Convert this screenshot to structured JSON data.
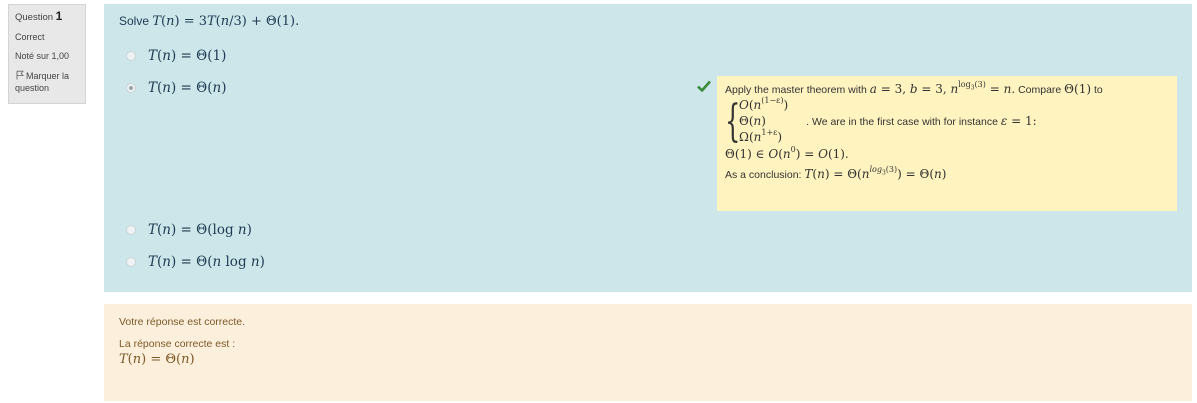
{
  "info": {
    "question_label": "Question",
    "question_number": "1",
    "state": "Correct",
    "grade": "Noté sur 1,00",
    "flag_label": "Marquer la question"
  },
  "question": {
    "prompt_word": "Solve",
    "options": [
      {
        "label": "T(n) = Θ(1)",
        "checked": false
      },
      {
        "label": "T(n) = Θ(n)",
        "checked": true
      },
      {
        "label": "T(n) = Θ(log n)",
        "checked": false
      },
      {
        "label": "T(n) = Θ(n log n)",
        "checked": false
      }
    ]
  },
  "feedback": {
    "intro": "Apply the master theorem with",
    "compare": "Compare",
    "to": "to",
    "first_case_text": "We are in the first case with for instance",
    "conclusion_label": "As a conclusion:"
  },
  "outcome": {
    "correct_text": "Votre réponse est correcte.",
    "right_answer_label": "La réponse correcte est :"
  },
  "colors": {
    "question_bg": "#cce6ea",
    "feedback_bg": "#fff3bf",
    "outcome_bg": "#fcefdc",
    "check": "#3a8a3a"
  }
}
